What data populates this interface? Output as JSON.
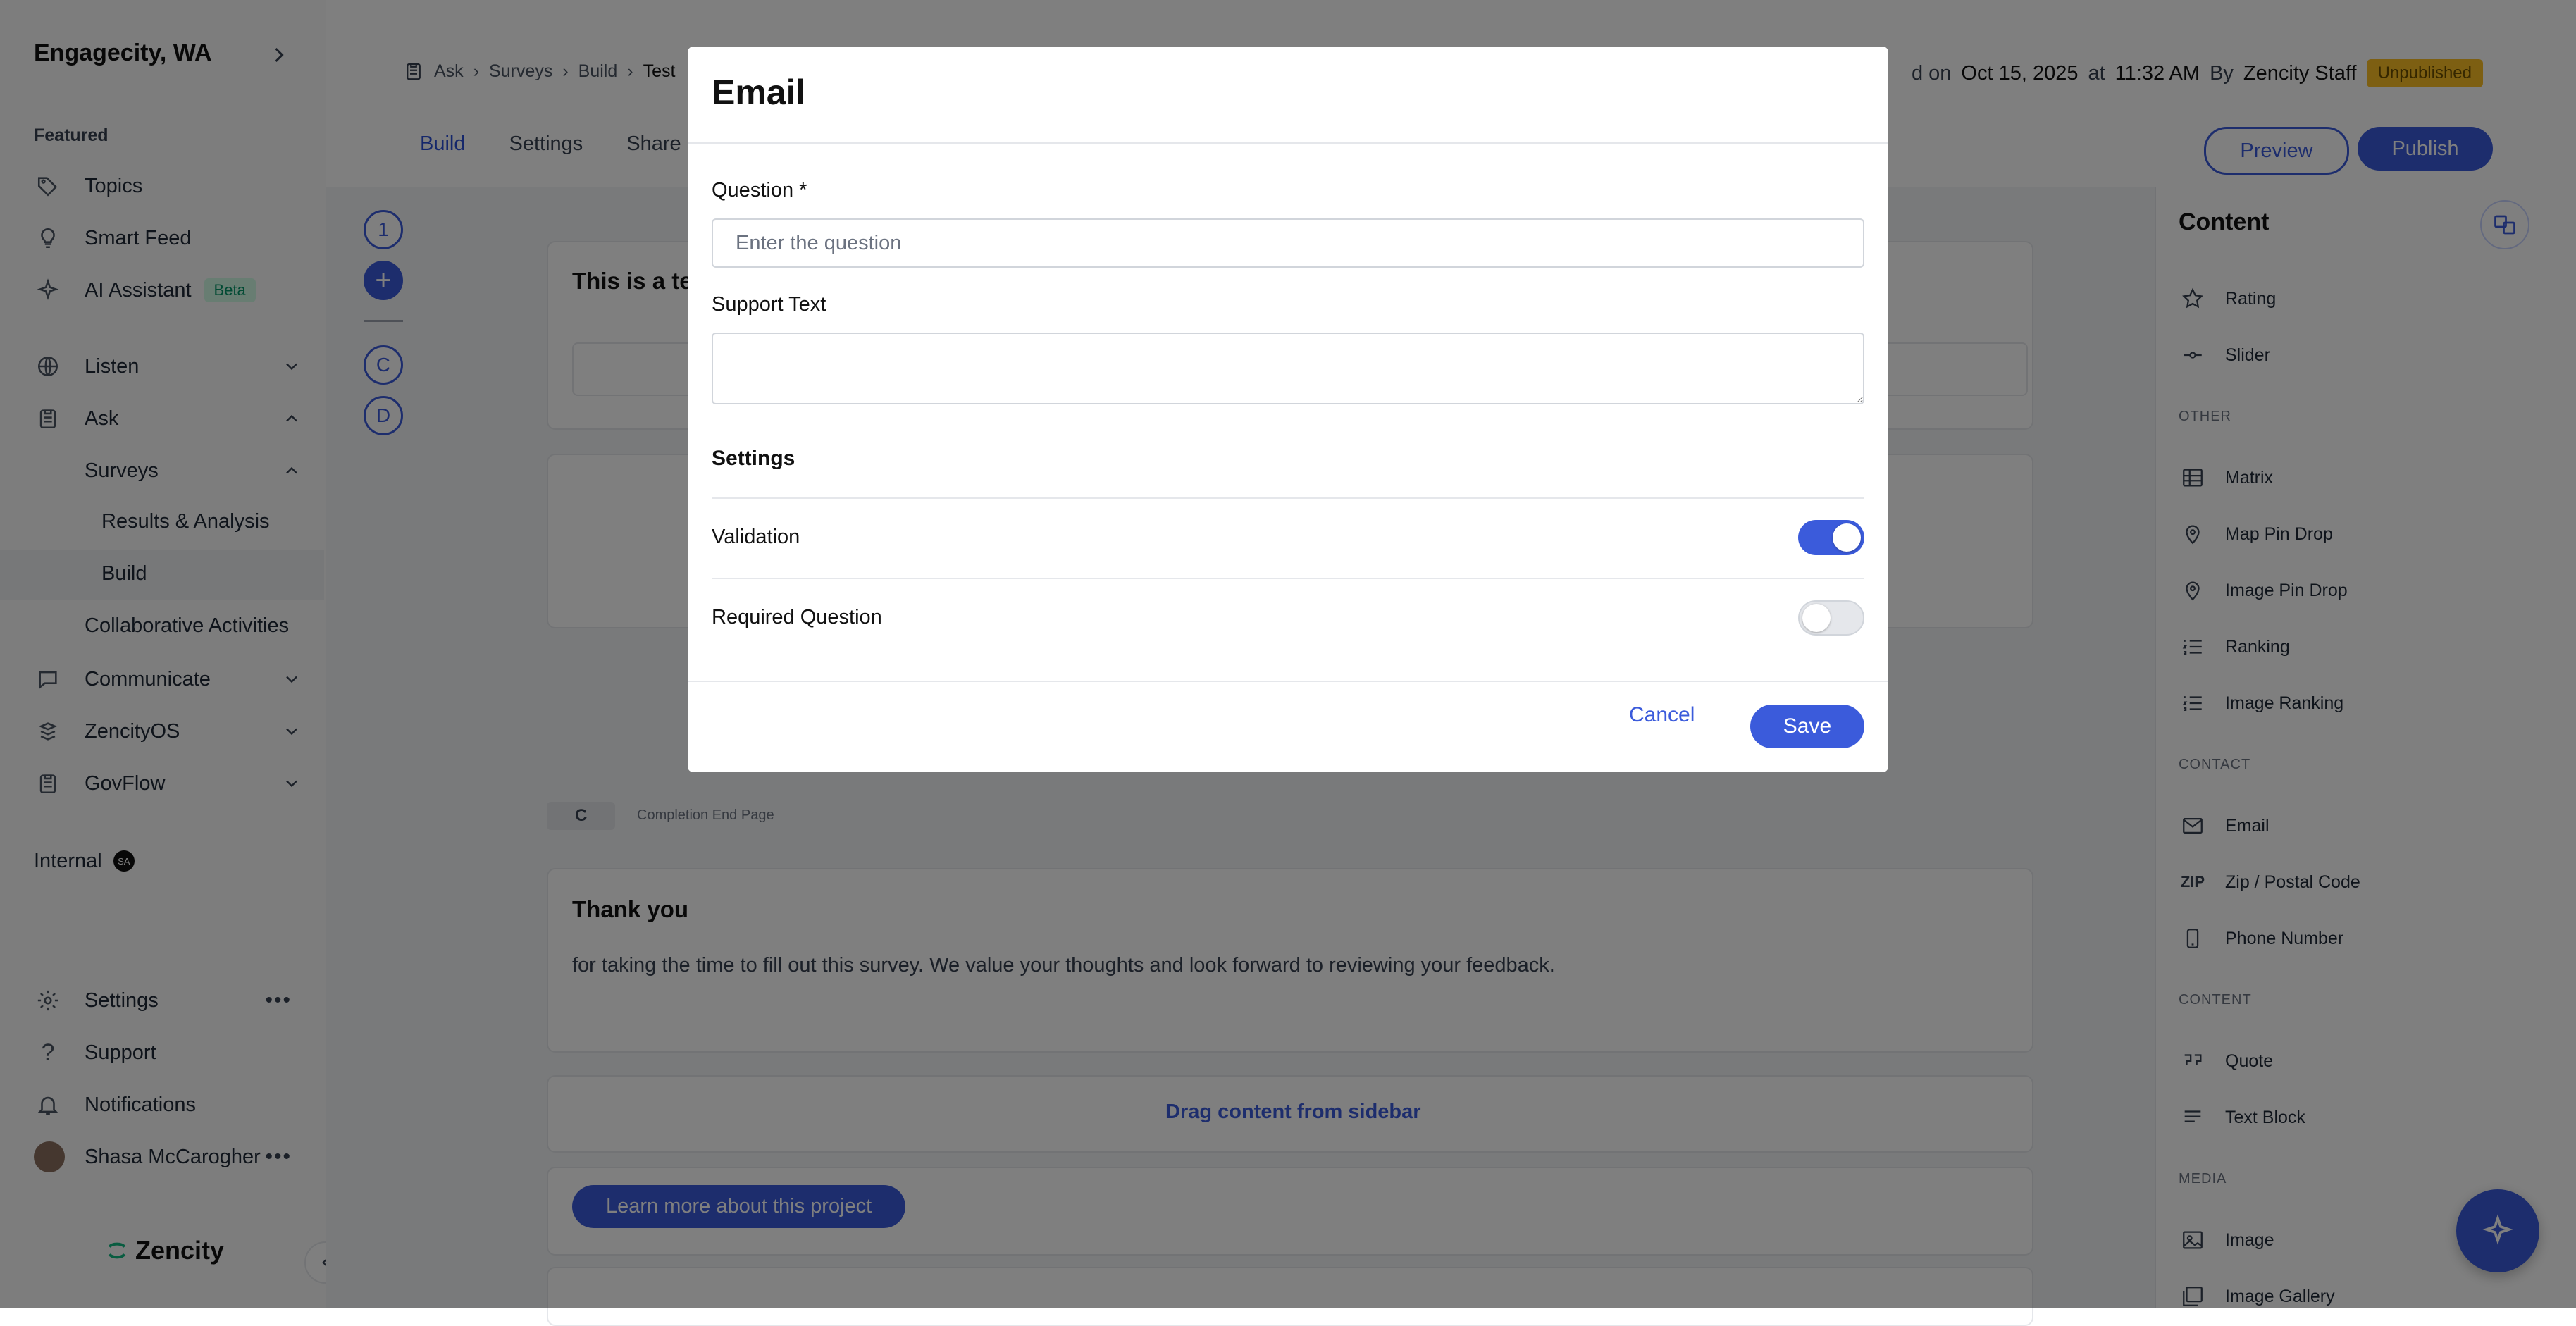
{
  "sidebar": {
    "org_name": "Engagecity, WA",
    "featured_label": "Featured",
    "items": [
      {
        "label": "Topics",
        "icon": "tag-icon"
      },
      {
        "label": "Smart Feed",
        "icon": "lightbulb-icon"
      },
      {
        "label": "AI Assistant",
        "icon": "sparkle-icon",
        "badge": "Beta"
      },
      {
        "label": "Listen",
        "icon": "globe-icon"
      },
      {
        "label": "Ask",
        "icon": "clipboard-icon"
      },
      {
        "label": "Communicate",
        "icon": "chat-icon"
      },
      {
        "label": "ZencityOS",
        "icon": "zencity-icon"
      },
      {
        "label": "GovFlow",
        "icon": "clipboard-icon"
      }
    ],
    "ask_sub": {
      "surveys": "Surveys",
      "results": "Results & Analysis",
      "build": "Build",
      "collab": "Collaborative Activities"
    },
    "internal_label": "Internal",
    "internal_badge": "SA",
    "bottom": {
      "settings": "Settings",
      "support": "Support",
      "notifications": "Notifications",
      "user": "Shasa McCarogher"
    },
    "logo_text": "Zencity"
  },
  "header": {
    "breadcrumb": [
      "Ask",
      "Surveys",
      "Build",
      "Test"
    ],
    "meta_prefix": "d on",
    "meta_date": "Oct 15, 2025",
    "meta_at": "at",
    "meta_time": "11:32 AM",
    "meta_by": "By",
    "meta_author": "Zencity Staff",
    "status_badge": "Unpublished",
    "tabs": [
      "Build",
      "Settings",
      "Share"
    ],
    "preview_label": "Preview",
    "publish_label": "Publish"
  },
  "canvas": {
    "steps": [
      "1",
      "+",
      "C",
      "D"
    ],
    "card1_title": "This is a te",
    "end_tag": "C",
    "end_tag_label": "Completion End Page",
    "thank_title": "Thank you",
    "thank_text": "for taking the time to fill out this survey. We value your thoughts and look forward to reviewing your feedback.",
    "drag_text": "Drag content from sidebar",
    "learn_more": "Learn more about this project"
  },
  "right_panel": {
    "title": "Content",
    "groups": [
      {
        "category": "",
        "items": [
          {
            "label": "Rating",
            "icon": "star-icon"
          },
          {
            "label": "Slider",
            "icon": "slider-icon"
          }
        ]
      },
      {
        "category": "OTHER",
        "items": [
          {
            "label": "Matrix",
            "icon": "table-icon"
          },
          {
            "label": "Map Pin Drop",
            "icon": "pin-icon"
          },
          {
            "label": "Image Pin Drop",
            "icon": "pin-icon"
          },
          {
            "label": "Ranking",
            "icon": "list-icon"
          },
          {
            "label": "Image Ranking",
            "icon": "list-icon"
          }
        ]
      },
      {
        "category": "CONTACT",
        "items": [
          {
            "label": "Email",
            "icon": "mail-icon"
          },
          {
            "label": "Zip / Postal Code",
            "icon": "zip-icon",
            "glyph": "ZIP"
          },
          {
            "label": "Phone Number",
            "icon": "phone-icon"
          }
        ]
      },
      {
        "category": "CONTENT",
        "items": [
          {
            "label": "Quote",
            "icon": "quote-icon"
          },
          {
            "label": "Text Block",
            "icon": "text-icon"
          }
        ]
      },
      {
        "category": "MEDIA",
        "items": [
          {
            "label": "Image",
            "icon": "image-icon"
          },
          {
            "label": "Image Gallery",
            "icon": "gallery-icon"
          }
        ]
      }
    ]
  },
  "modal": {
    "title": "Email",
    "question_label": "Question *",
    "question_placeholder": "Enter the question",
    "question_value": "",
    "support_label": "Support Text",
    "support_value": "",
    "settings_title": "Settings",
    "validation_label": "Validation",
    "validation_on": true,
    "required_label": "Required Question",
    "required_on": false,
    "cancel_label": "Cancel",
    "save_label": "Save"
  },
  "colors": {
    "accent": "#3b5bdb",
    "badge_bg": "#fbbf24",
    "overlay": "rgba(0,0,0,0.5)"
  }
}
